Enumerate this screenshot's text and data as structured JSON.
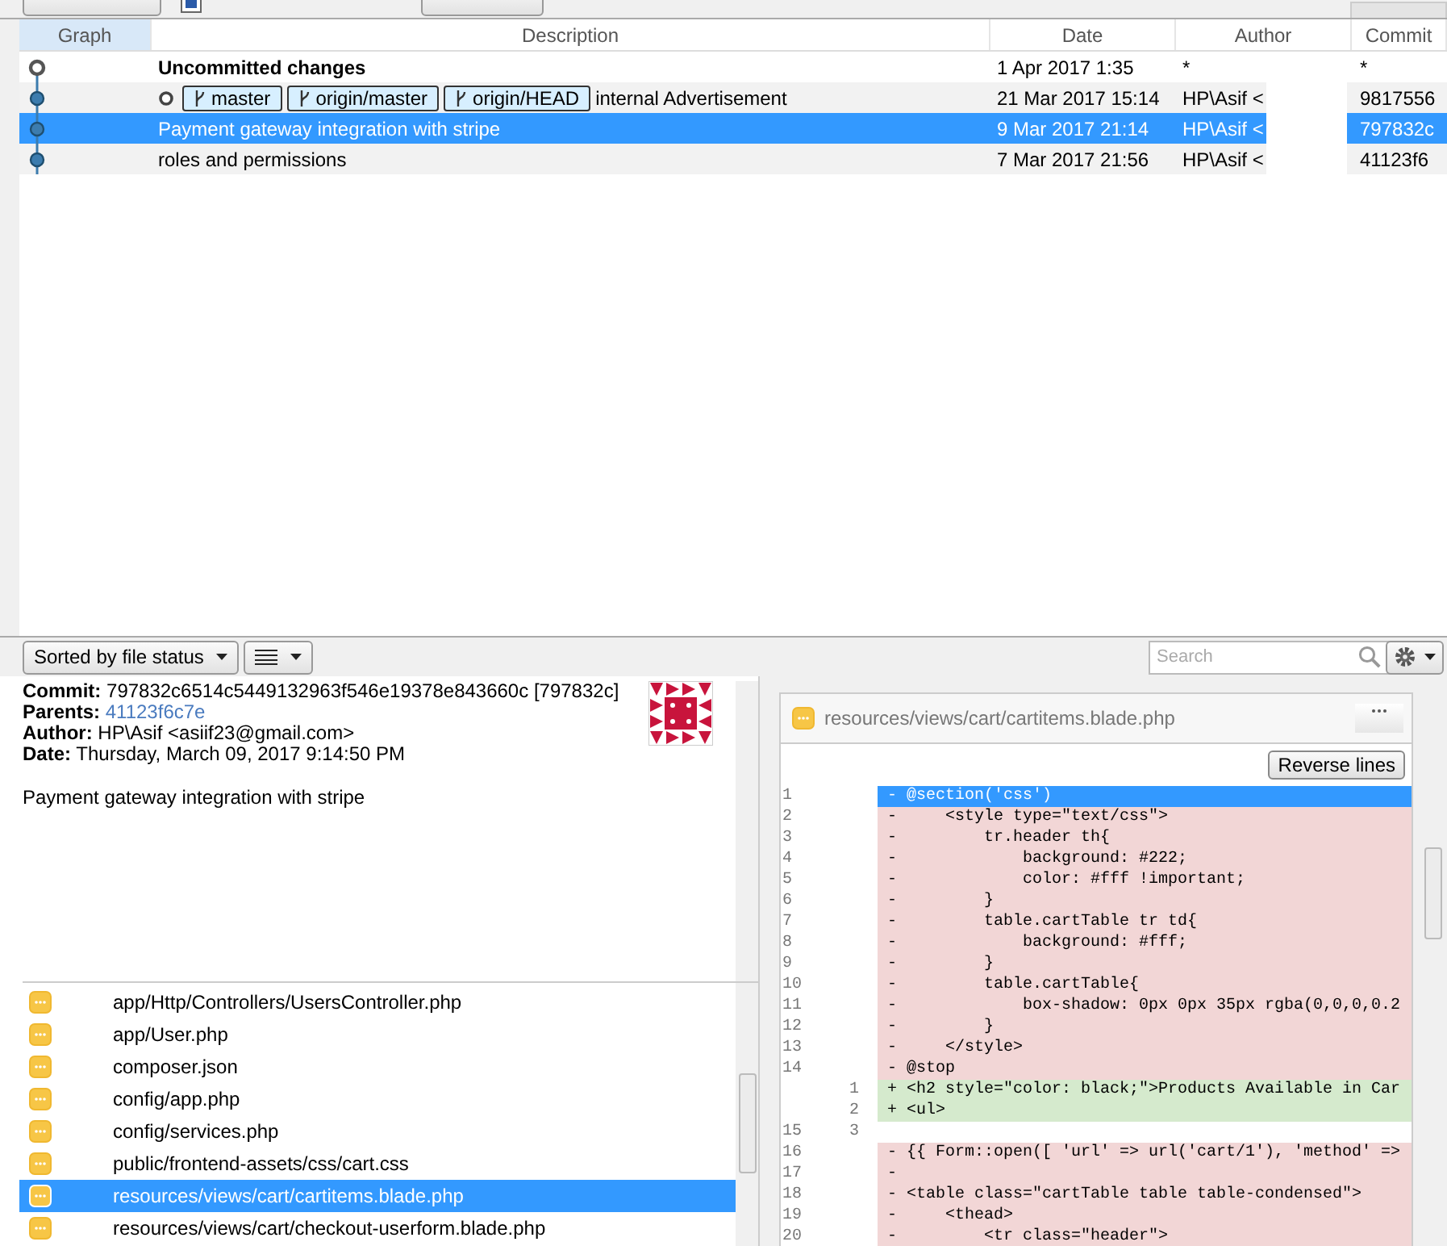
{
  "toolbar": {
    "show_remote": {
      "checked": true
    }
  },
  "commits": {
    "columns": [
      "Graph",
      "Description",
      "Date",
      "Author",
      "Commit"
    ],
    "rows": [
      {
        "kind": "uncommitted",
        "description": "Uncommitted changes",
        "tags": [],
        "date": "1 Apr 2017 1:35",
        "author": "*",
        "commit": "*",
        "selected": false
      },
      {
        "kind": "commit",
        "description": "internal Advertisement",
        "tags": [
          "master",
          "origin/master",
          "origin/HEAD"
        ],
        "date": "21 Mar 2017 15:14",
        "author": "HP\\Asif <",
        "commit": "9817556",
        "selected": false
      },
      {
        "kind": "commit",
        "description": "Payment gateway integration with stripe",
        "tags": [],
        "date": "9 Mar 2017 21:14",
        "author": "HP\\Asif <",
        "commit": "797832c",
        "selected": true
      },
      {
        "kind": "commit",
        "description": "roles and permissions",
        "tags": [],
        "date": "7 Mar 2017 21:56",
        "author": "HP\\Asif <",
        "commit": "41123f6",
        "selected": false
      }
    ]
  },
  "lower_toolbar": {
    "sort": "Sorted by file status",
    "search": {
      "placeholder": "Search"
    }
  },
  "details": {
    "commit_label": "Commit:",
    "commit": "797832c6514c5449132963f546e19378e843660c [797832c]",
    "parents_label": "Parents:",
    "parents": "41123f6c7e",
    "author_label": "Author:",
    "author": "HP\\Asif <asiif23@gmail.com>",
    "date_label": "Date:",
    "date": "Thursday, March 09, 2017 9:14:50 PM",
    "message": "Payment gateway integration with stripe"
  },
  "files": [
    {
      "path": "app/Http/Controllers/UsersController.php",
      "selected": false
    },
    {
      "path": "app/User.php",
      "selected": false
    },
    {
      "path": "composer.json",
      "selected": false
    },
    {
      "path": "config/app.php",
      "selected": false
    },
    {
      "path": "config/services.php",
      "selected": false
    },
    {
      "path": "public/frontend-assets/css/cart.css",
      "selected": false
    },
    {
      "path": "resources/views/cart/cartitems.blade.php",
      "selected": true
    },
    {
      "path": "resources/views/cart/checkout-userform.blade.php",
      "selected": false
    }
  ],
  "diff": {
    "file": "resources/views/cart/cartitems.blade.php",
    "button": "Reverse lines",
    "lines": [
      {
        "old": "1",
        "text": "- @section('css')",
        "kind": "removed",
        "selected": true
      },
      {
        "old": "2",
        "text": "-     <style type=\"text/css\">",
        "kind": "removed",
        "selected": false
      },
      {
        "old": "3",
        "text": "-         tr.header th{",
        "kind": "removed",
        "selected": false
      },
      {
        "old": "4",
        "text": "-             background: #222;",
        "kind": "removed",
        "selected": false
      },
      {
        "old": "5",
        "text": "-             color: #fff !important;",
        "kind": "removed",
        "selected": false
      },
      {
        "old": "6",
        "text": "-         }",
        "kind": "removed",
        "selected": false
      },
      {
        "old": "7",
        "text": "-         table.cartTable tr td{",
        "kind": "removed",
        "selected": false
      },
      {
        "old": "8",
        "text": "-             background: #fff;",
        "kind": "removed",
        "selected": false
      },
      {
        "old": "9",
        "text": "-         }",
        "kind": "removed",
        "selected": false
      },
      {
        "old": "10",
        "text": "-         table.cartTable{",
        "kind": "removed",
        "selected": false
      },
      {
        "old": "11",
        "text": "-             box-shadow: 0px 0px 35px rgba(0,0,0,0.2",
        "kind": "removed",
        "selected": false
      },
      {
        "old": "12",
        "text": "-         }",
        "kind": "removed",
        "selected": false
      },
      {
        "old": "13",
        "text": "-     </style>",
        "kind": "removed",
        "selected": false
      },
      {
        "old": "14",
        "text": "- @stop",
        "kind": "removed",
        "selected": false
      },
      {
        "new": "1",
        "text": "+ <h2 style=\"color: black;\">Products Available in Car",
        "kind": "added",
        "selected": false
      },
      {
        "new": "2",
        "text": "+ <ul>",
        "kind": "added",
        "selected": false
      },
      {
        "old": "15",
        "new": "3",
        "kind": "context",
        "selected": false
      },
      {
        "old": "16",
        "text": "- {{ Form::open([ 'url' => url('cart/1'), 'method' =>",
        "kind": "removed",
        "selected": false
      },
      {
        "old": "17",
        "text": "-",
        "kind": "removed",
        "selected": false
      },
      {
        "old": "18",
        "text": "- <table class=\"cartTable table table-condensed\">",
        "kind": "removed",
        "selected": false
      },
      {
        "old": "19",
        "text": "-     <thead>",
        "kind": "removed",
        "selected": false
      },
      {
        "old": "20",
        "text": "-         <tr class=\"header\">",
        "kind": "removed",
        "selected": false
      }
    ]
  }
}
